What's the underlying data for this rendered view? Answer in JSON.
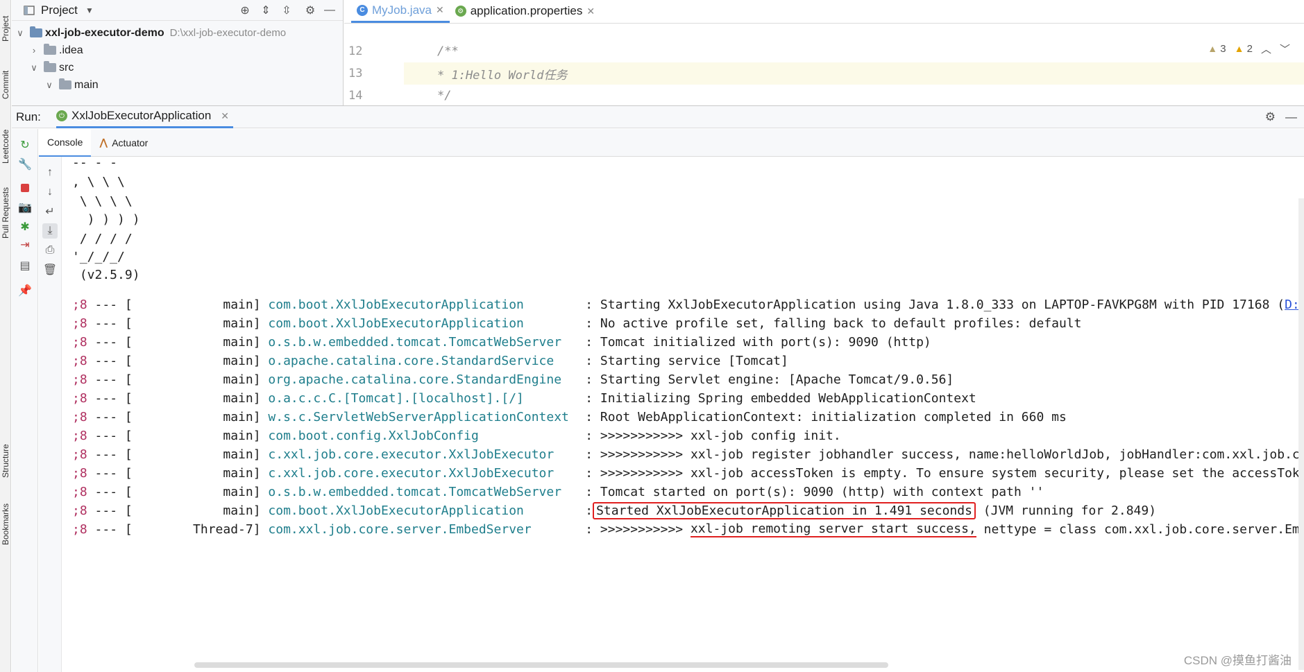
{
  "side_tabs": [
    "Project",
    "Commit",
    "Leetcode",
    "Pull Requests",
    "Structure",
    "Bookmarks"
  ],
  "project": {
    "title": "Project",
    "root_name": "xxl-job-executor-demo",
    "root_path": "D:\\xxl-job-executor-demo",
    "items": [
      {
        "label": ".idea",
        "level": 1,
        "expanded": false
      },
      {
        "label": "src",
        "level": 1,
        "expanded": true
      },
      {
        "label": "main",
        "level": 2,
        "expanded": true
      }
    ]
  },
  "editor": {
    "tabs": [
      {
        "label": "MyJob.java",
        "active": true
      },
      {
        "label": "application.properties",
        "active": false
      }
    ],
    "lines": [
      {
        "num": "12",
        "text": "/**"
      },
      {
        "num": "13",
        "text": " * 1:Hello World任务"
      },
      {
        "num": "14",
        "text": " */"
      }
    ],
    "inspections": {
      "warnings": "3",
      "weak_warnings": "2"
    }
  },
  "run": {
    "label": "Run:",
    "tab_label": "XxlJobExecutorApplication",
    "subtabs": [
      "Console",
      "Actuator"
    ]
  },
  "banner": [
    "-- - -",
    ", \\ \\ \\",
    " \\ \\ \\ \\",
    "  ) ) ) )",
    " / / / /",
    "'_/_/_/",
    " (v2.5.9)"
  ],
  "log_lines": [
    {
      "pid": ";8",
      "thread": "main",
      "logger": "com.boot.XxlJobExecutorApplication",
      "message": "Starting XxlJobExecutorApplication using Java 1.8.0_333 on LAPTOP-FAVKPG8M with PID 17168 (",
      "link": "D:\\"
    },
    {
      "pid": ";8",
      "thread": "main",
      "logger": "com.boot.XxlJobExecutorApplication",
      "message": "No active profile set, falling back to default profiles: default"
    },
    {
      "pid": ";8",
      "thread": "main",
      "logger": "o.s.b.w.embedded.tomcat.TomcatWebServer",
      "message": "Tomcat initialized with port(s): 9090 (http)"
    },
    {
      "pid": ";8",
      "thread": "main",
      "logger": "o.apache.catalina.core.StandardService",
      "message": "Starting service [Tomcat]"
    },
    {
      "pid": ";8",
      "thread": "main",
      "logger": "org.apache.catalina.core.StandardEngine",
      "message": "Starting Servlet engine: [Apache Tomcat/9.0.56]"
    },
    {
      "pid": ";8",
      "thread": "main",
      "logger": "o.a.c.c.C.[Tomcat].[localhost].[/]",
      "message": "Initializing Spring embedded WebApplicationContext"
    },
    {
      "pid": ";8",
      "thread": "main",
      "logger": "w.s.c.ServletWebServerApplicationContext",
      "message": "Root WebApplicationContext: initialization completed in 660 ms"
    },
    {
      "pid": ";8",
      "thread": "main",
      "logger": "com.boot.config.XxlJobConfig",
      "message": ">>>>>>>>>>> xxl-job config init."
    },
    {
      "pid": ";8",
      "thread": "main",
      "logger": "c.xxl.job.core.executor.XxlJobExecutor",
      "message": ">>>>>>>>>>> xxl-job register jobhandler success, name:helloWorldJob, jobHandler:com.xxl.job.co"
    },
    {
      "pid": ";8",
      "thread": "main",
      "logger": "c.xxl.job.core.executor.XxlJobExecutor",
      "message": ">>>>>>>>>>> xxl-job accessToken is empty. To ensure system security, please set the accessToke"
    },
    {
      "pid": ";8",
      "thread": "main",
      "logger": "o.s.b.w.embedded.tomcat.TomcatWebServer",
      "message": "Tomcat started on port(s): 9090 (http) with context path ''"
    },
    {
      "pid": ";8",
      "thread": "main",
      "logger": "com.boot.XxlJobExecutorApplication",
      "message": "Started XxlJobExecutorApplication in 1.491 seconds",
      "suffix": " (JVM running for 2.849)",
      "boxed": true
    },
    {
      "pid": ";8",
      "thread": "Thread-7",
      "logger": "com.xxl.job.core.server.EmbedServer",
      "prefix": ">>>>>>>>>>> ",
      "message": "xxl-job remoting server start success,",
      "suffix": " nettype = class com.xxl.job.core.server.Emb",
      "underlined": true
    }
  ],
  "watermark": "CSDN @摸鱼打酱油",
  "colors": {
    "accent": "#4a8ce0",
    "logger": "#1f7e8c",
    "pid": "#b03060",
    "annotation": "#e02020"
  }
}
